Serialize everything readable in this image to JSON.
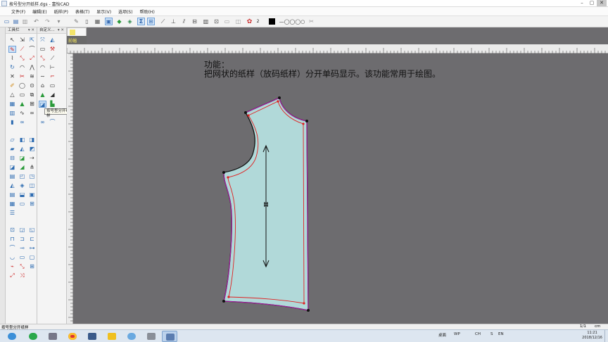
{
  "window": {
    "title": "按号型分开纸样.dgs - 富怡CAD",
    "buttons": [
      "–",
      "▢",
      "✕"
    ]
  },
  "menu": [
    "文件(F)",
    "编辑(E)",
    "纸样(P)",
    "表格(T)",
    "显示(V)",
    "选项(S)",
    "帮助(H)"
  ],
  "toolbar": {
    "size_label": "2"
  },
  "panels": {
    "tools": {
      "title": "工具栏",
      "pin": "▾ ✕"
    },
    "custom": {
      "title": "自定义...",
      "pin": "▾ ✕"
    }
  },
  "tooltip": "按号型分开纸样",
  "sheet": {
    "tab_label": "前幅",
    "tab_number": "1",
    "header_label": "前幅"
  },
  "canvas": {
    "note_title": "功能：",
    "note_body": "把网状的纸样（放码纸样）分开单码显示。该功能常用于绘图。"
  },
  "status": {
    "left": "按号型分开纸样",
    "page": "1/1",
    "unit": "cm"
  },
  "taskbar": {
    "tray_items": [
      "桌面",
      "WP",
      "CH",
      "S",
      "EN"
    ],
    "time": "11:21",
    "date": "2018/12/16"
  },
  "colors": {
    "canvas": "#6d6c6f",
    "pattern_fill": "#b1d9d9",
    "pattern_outline": "#111111",
    "seam_line": "#e02020",
    "outer_highlight": "#d21cc9",
    "grainline": "#111111"
  }
}
